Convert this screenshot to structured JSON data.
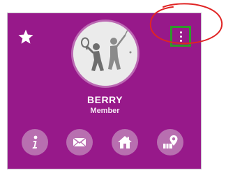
{
  "profile": {
    "name": "BERRY",
    "role": "Member"
  },
  "icons": {
    "favorite": "star-icon",
    "more": "vertical-ellipsis-icon",
    "avatar": "tennis-golf-players-icon",
    "info": "info-icon",
    "message": "envelope-icon",
    "home": "house-icon",
    "location": "map-pin-icon"
  },
  "colors": {
    "card_background": "#97198a",
    "action_button": "#b86fb0",
    "highlight_box": "#2e9a2a",
    "annotation_circle": "#e02424"
  }
}
